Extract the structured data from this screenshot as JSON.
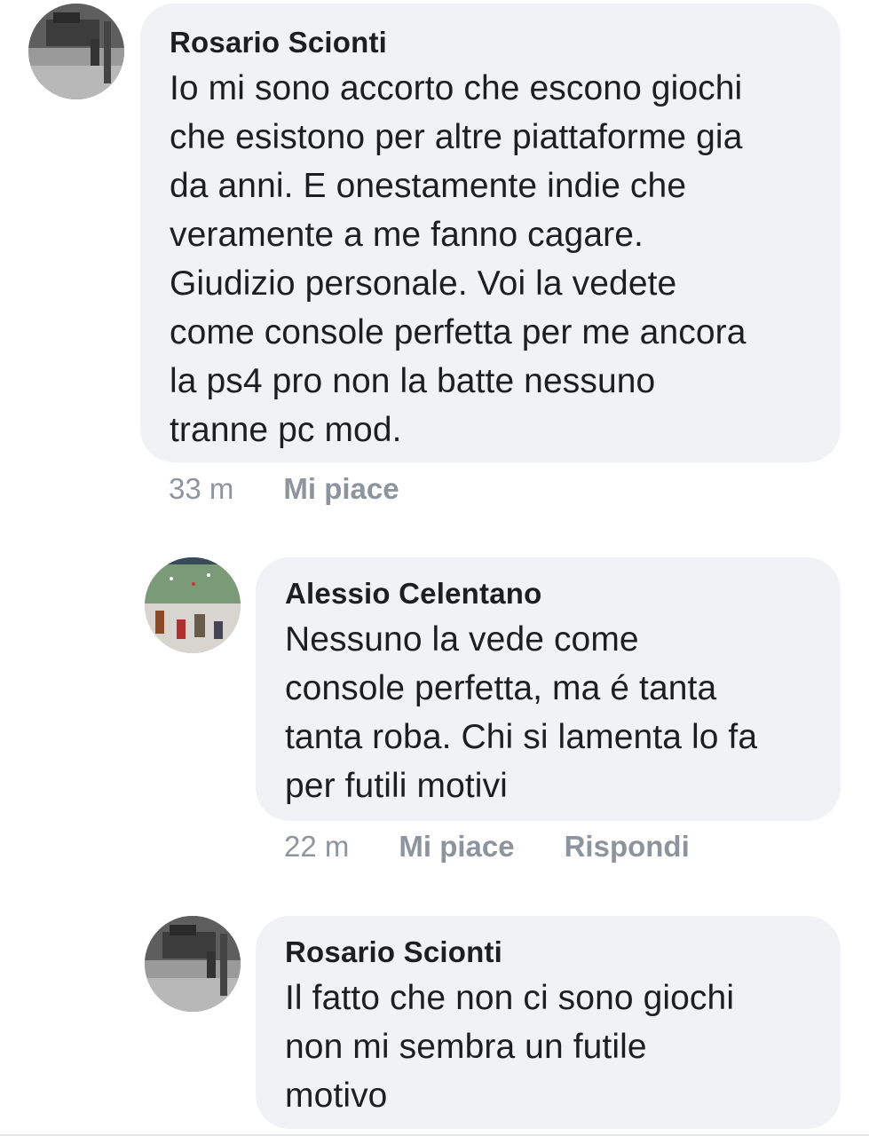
{
  "comments": [
    {
      "author": "Rosario Scionti",
      "avatar_icon": "profile-photo-gray",
      "lines": [
        "Io mi sono accorto che escono giochi",
        "che esistono per altre piattaforme gia",
        "da anni. E onestamente indie che",
        "veramente a me fanno cagare.",
        "Giudizio personale. Voi la vedete",
        "come console perfetta per me ancora",
        "la ps4 pro non la batte nessuno",
        "tranne pc mod."
      ],
      "time": "33 m",
      "like_label": "Mi piace"
    },
    {
      "author": "Alessio Celentano",
      "avatar_icon": "profile-photo-football",
      "lines": [
        "Nessuno la vede come",
        "console perfetta, ma é tanta",
        "tanta roba. Chi si lamenta lo fa",
        "per futili motivi"
      ],
      "time": "22 m",
      "like_label": "Mi piace",
      "reply_label": "Rispondi"
    },
    {
      "author": "Rosario Scionti",
      "avatar_icon": "profile-photo-gray",
      "lines": [
        "Il fatto che non ci sono giochi",
        "non mi sembra un futile",
        "motivo"
      ]
    }
  ],
  "colors": {
    "bubble_bg": "#f0f2f5",
    "text": "#1c1e21",
    "meta_gray": "#90949c"
  }
}
